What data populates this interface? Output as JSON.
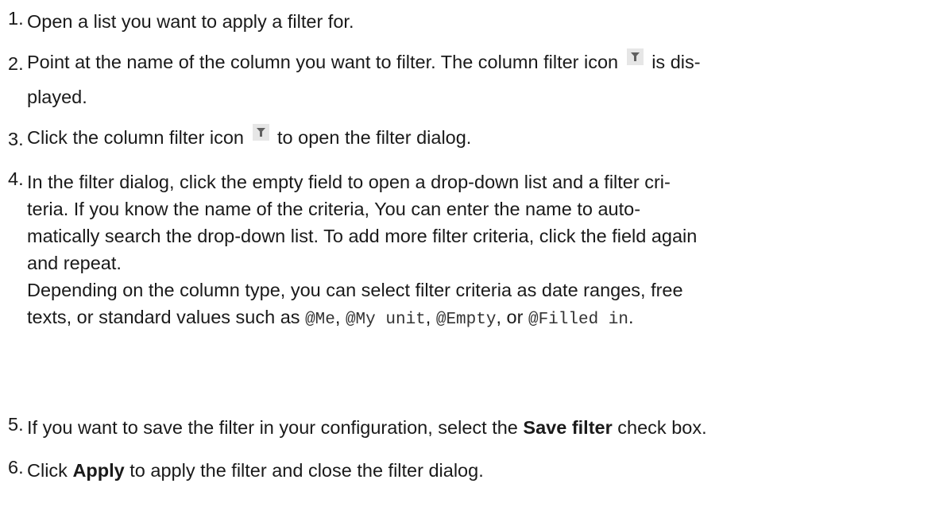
{
  "steps": [
    {
      "number": "1.",
      "text": "Open a list you want to apply a filter for."
    },
    {
      "number": "2.",
      "text_before_icon": "Point at the name of the column you want to filter. The column filter icon",
      "text_after_icon": "is dis-",
      "text_line2": "played."
    },
    {
      "number": "3.",
      "text_before_icon": "Click the column filter icon",
      "text_after_icon": "to open the filter dialog."
    },
    {
      "number": "4.",
      "lines": [
        "In the filter dialog, click the empty field to open a drop-down list and a filter cri-",
        "teria. If you know the name of the criteria, You can enter the name to auto-",
        "matically search the drop-down list. To add more filter criteria, click the field again",
        "and repeat."
      ],
      "note_line1": "Depending on the column type, you can select filter criteria as date ranges, free",
      "note_line2_prefix": "texts, or standard values such as",
      "values": [
        "@Me",
        "@My unit",
        "@Empty",
        "@Filled in"
      ],
      "comma": ",",
      "or_word": "or",
      "period": "."
    },
    {
      "number": "5.",
      "text_before": "If you want to save the filter in your configuration, select the",
      "bold": "Save filter",
      "text_after": "check box."
    },
    {
      "number": "6.",
      "text_before": "Click",
      "bold": "Apply",
      "text_after": "to apply the filter and close the filter dialog."
    }
  ],
  "icon": {
    "name": "column-filter-icon",
    "color": "#5f5f5f",
    "background": "#e6e6e6"
  }
}
